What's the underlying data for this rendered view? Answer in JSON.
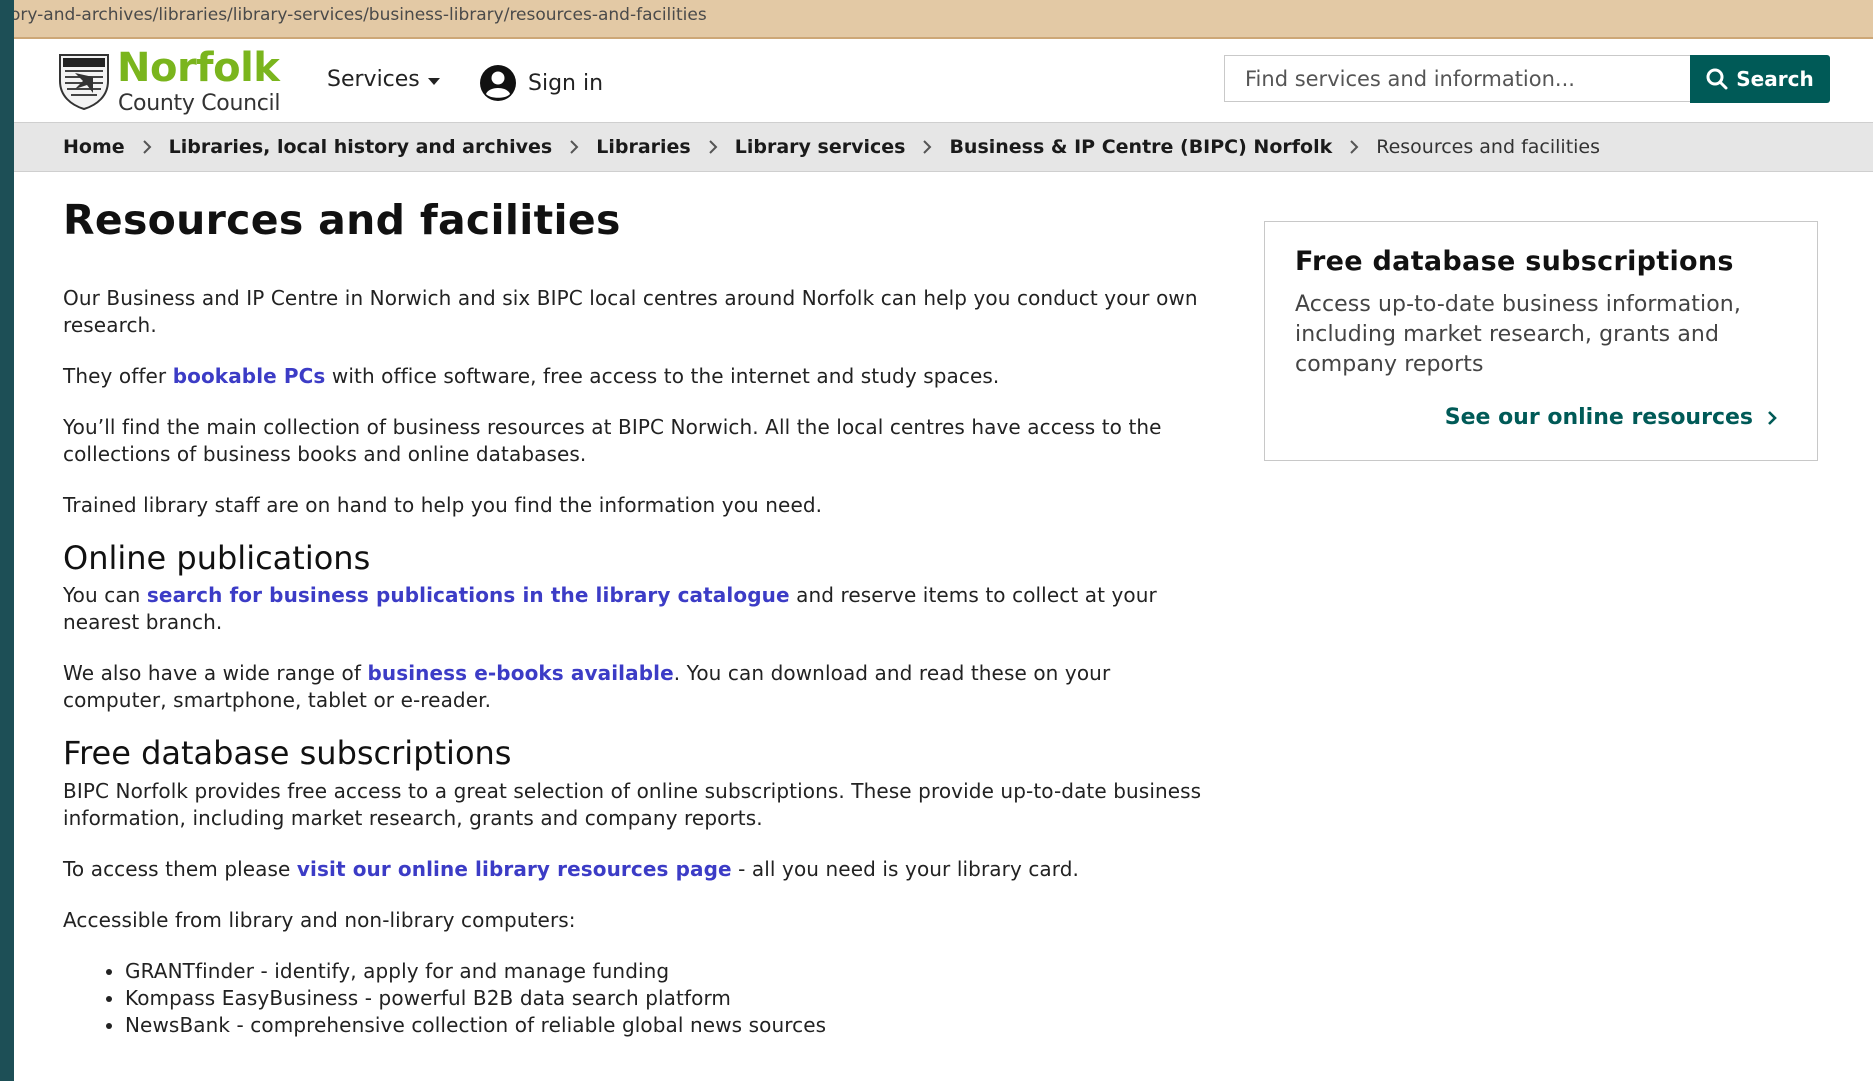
{
  "browser": {
    "url": "ory-and-archives/libraries/library-services/business-library/resources-and-facilities"
  },
  "header": {
    "logo_main": "Norfolk",
    "logo_sub": "County Council",
    "services_label": "Services",
    "signin_label": "Sign in",
    "search_placeholder": "Find services and information...",
    "search_button": "Search"
  },
  "breadcrumb": [
    "Home",
    "Libraries, local history and archives",
    "Libraries",
    "Library services",
    "Business & IP Centre (BIPC) Norfolk",
    "Resources and facilities"
  ],
  "main": {
    "title": "Resources and facilities",
    "intro": {
      "p1": "Our Business and IP Centre in Norwich and six BIPC local centres around Norfolk can help you conduct your own research.",
      "p2_pre": "They offer ",
      "p2_link": "bookable PCs",
      "p2_post": " with office software, free access to the internet and study spaces.",
      "p3": "You’ll find the main collection of business resources at BIPC Norwich. All the local centres have access to the collections of business books and online databases.",
      "p4": "Trained library staff are on hand to help you find the information you need."
    },
    "online": {
      "heading": "Online publications",
      "p1_pre": "You can ",
      "p1_link": "search for business publications in the library catalogue",
      "p1_post": " and reserve items to collect at your nearest branch.",
      "p2_pre": "We also have a wide range of ",
      "p2_link": "business e-books available",
      "p2_post": ". You can download and read these on your computer, smartphone, tablet or e-reader."
    },
    "databases": {
      "heading": "Free database subscriptions",
      "p1": "BIPC Norfolk provides free access to a great selection of online subscriptions. These provide up-to-date business information, including market research, grants and company reports.",
      "p2_pre": "To access them please ",
      "p2_link": "visit our online library resources page",
      "p2_post": " - all you need is your library card.",
      "p3": "Accessible from library and non-library computers:",
      "list": [
        "GRANTfinder - identify, apply for and manage funding",
        "Kompass EasyBusiness - powerful B2B data search platform",
        "NewsBank - comprehensive collection of reliable global news sources"
      ]
    }
  },
  "aside": {
    "title": "Free database subscriptions",
    "text": "Access up-to-date business information, including market research, grants and company reports",
    "link": "See our online resources"
  },
  "colors": {
    "brand_green": "#7ab51d",
    "teal": "#005a57",
    "link": "#3c3cc6",
    "breadcrumb_bg": "#e6e6e6"
  },
  "icons": [
    "norfolk-crest-icon",
    "caret-down-icon",
    "user-circle-icon",
    "search-icon",
    "chevron-right-icon"
  ]
}
